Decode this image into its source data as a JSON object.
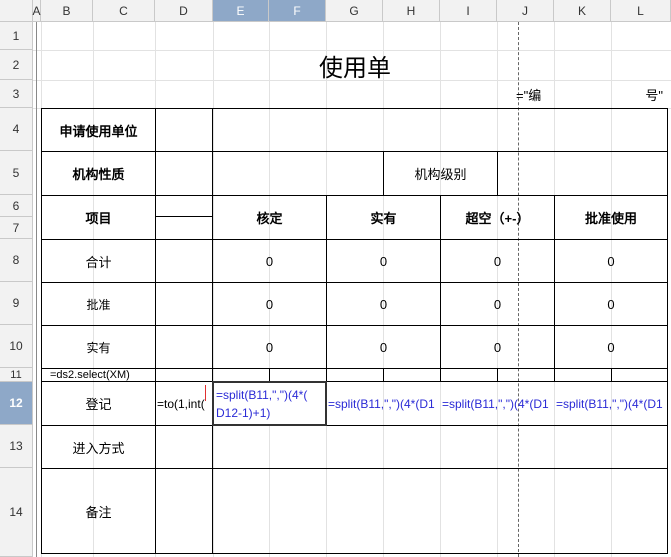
{
  "columns": [
    "A",
    "B",
    "C",
    "D",
    "E",
    "F",
    "G",
    "H",
    "I",
    "J",
    "K",
    "L"
  ],
  "rows": [
    "1",
    "2",
    "3",
    "4",
    "5",
    "6",
    "7",
    "8",
    "9",
    "10",
    "11",
    "12",
    "13",
    "14"
  ],
  "title": "使用单",
  "serial": {
    "left": "=\"编",
    "right": "号\""
  },
  "labels": {
    "apply_unit": "申请使用单位",
    "org_nature": "机构性质",
    "org_level": "机构级别",
    "item": "项目",
    "approved_limit": "核定",
    "actual": "实有",
    "over_empty": "超空（+-）",
    "approve_use": "批准使用",
    "total": "合计",
    "approve": "批准",
    "real": "实有",
    "register": "登记",
    "entry_method": "进入方式",
    "remark": "备注"
  },
  "values": {
    "total": [
      "0",
      "0",
      "0",
      "0"
    ],
    "approve": [
      "0",
      "0",
      "0",
      "0"
    ],
    "real": [
      "0",
      "0",
      "0",
      "0"
    ]
  },
  "formulas": {
    "b11": "=ds2.select(XM)",
    "d12": "=to(1,int(",
    "e12_line1": "=split(B11,\",\")(4*(",
    "e12_line2": "D12-1)+1)",
    "g12": "=split(B11,\",\")(4*(D1",
    "i12": "=split(B11,\",\")(4*(D1",
    "k12": "=split(B11,\",\")(4*(D1"
  }
}
